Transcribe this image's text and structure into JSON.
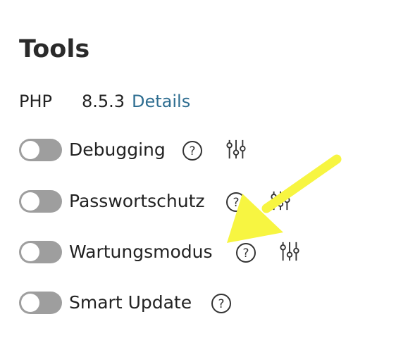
{
  "title": "Tools",
  "php": {
    "label": "PHP",
    "version": "8.5.3",
    "details_link": "Details"
  },
  "tools": [
    {
      "label": "Debugging",
      "enabled": false,
      "has_settings": true
    },
    {
      "label": "Passwortschutz",
      "enabled": false,
      "has_settings": true
    },
    {
      "label": "Wartungsmodus",
      "enabled": false,
      "has_settings": true
    },
    {
      "label": "Smart Update",
      "enabled": false,
      "has_settings": false
    }
  ],
  "icons": {
    "help": "question-circle-icon",
    "settings": "sliders-icon"
  },
  "colors": {
    "link": "#2f6e91",
    "toggle_off": "#9e9e9e",
    "annotation_arrow": "#f7f541",
    "text": "#222222"
  }
}
